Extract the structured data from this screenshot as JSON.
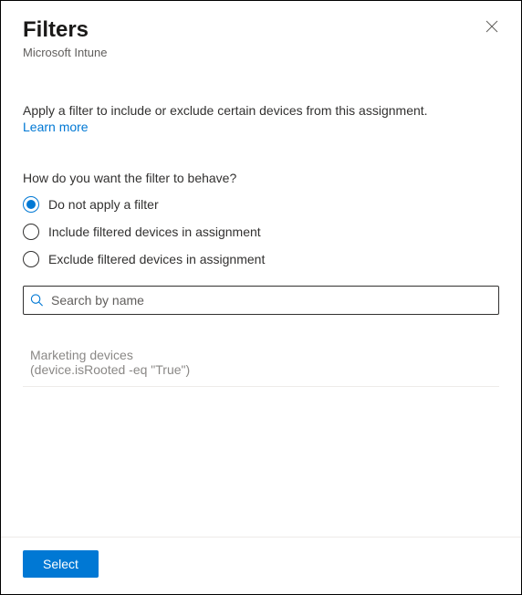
{
  "header": {
    "title": "Filters",
    "subtitle": "Microsoft Intune"
  },
  "body": {
    "intro": "Apply a filter to include or exclude certain devices from this assignment.",
    "learn_more": "Learn more",
    "question": "How do you want the filter to behave?",
    "radios": [
      {
        "label": "Do not apply a filter",
        "selected": true
      },
      {
        "label": "Include filtered devices in assignment",
        "selected": false
      },
      {
        "label": "Exclude filtered devices in assignment",
        "selected": false
      }
    ],
    "search": {
      "placeholder": "Search by name",
      "value": ""
    },
    "filters": [
      {
        "name": "Marketing devices",
        "rule": "(device.isRooted -eq \"True\")"
      }
    ]
  },
  "footer": {
    "select_label": "Select"
  }
}
